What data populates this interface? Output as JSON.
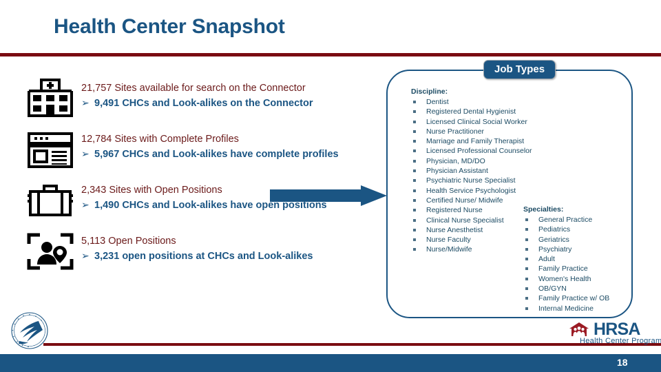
{
  "slide": {
    "title": "Health Center Snapshot",
    "page_number": "18",
    "accent_blue": "#1b5583",
    "accent_red": "#7a0c11",
    "stat_text_color": "#6b1a1a"
  },
  "stats": [
    {
      "icon": "hospital-building-icon",
      "main": "21,757 Sites available for search on the Connector",
      "bullet": "➢",
      "sub": "9,491 CHCs and Look-alikes on the Connector"
    },
    {
      "icon": "profile-page-icon",
      "main": "12,784 Sites with Complete Profiles",
      "bullet": "➢",
      "sub": "5,967 CHCs and Look-alikes have complete profiles"
    },
    {
      "icon": "briefcase-icon",
      "main": "2,343 Sites with Open Positions",
      "bullet": "➢",
      "sub": "1,490 CHCs and Look-alikes have open positions"
    },
    {
      "icon": "person-location-icon",
      "main": "5,113 Open Positions",
      "bullet": "➢",
      "sub": "3,231 open positions at CHCs and Look-alikes"
    }
  ],
  "panel": {
    "badge_label": "Job Types",
    "discipline": {
      "heading": "Discipline:",
      "items": [
        "Dentist",
        "Registered Dental Hygienist",
        "Licensed Clinical Social Worker",
        "Nurse Practitioner",
        "Marriage and Family Therapist",
        "Licensed Professional Counselor",
        "Physician, MD/DO",
        "Physician Assistant",
        "Psychiatric Nurse Specialist",
        "Health Service Psychologist",
        "Certified Nurse/ Midwife",
        "Registered Nurse",
        "Clinical Nurse Specialist",
        "Nurse Anesthetist",
        "Nurse Faculty",
        "Nurse/Midwife"
      ]
    },
    "specialties": {
      "heading": "Specialties:",
      "items": [
        "General Practice",
        "Pediatrics",
        "Geriatrics",
        "Psychiatry",
        "Adult",
        "Family Practice",
        "Women's Health",
        "OB/GYN",
        "Family Practice w/ OB",
        "Internal Medicine"
      ]
    }
  },
  "footer": {
    "hrsa_name": "HRSA",
    "hrsa_program": "Health Center Program",
    "hhs_seal": "hhs-seal-logo"
  }
}
